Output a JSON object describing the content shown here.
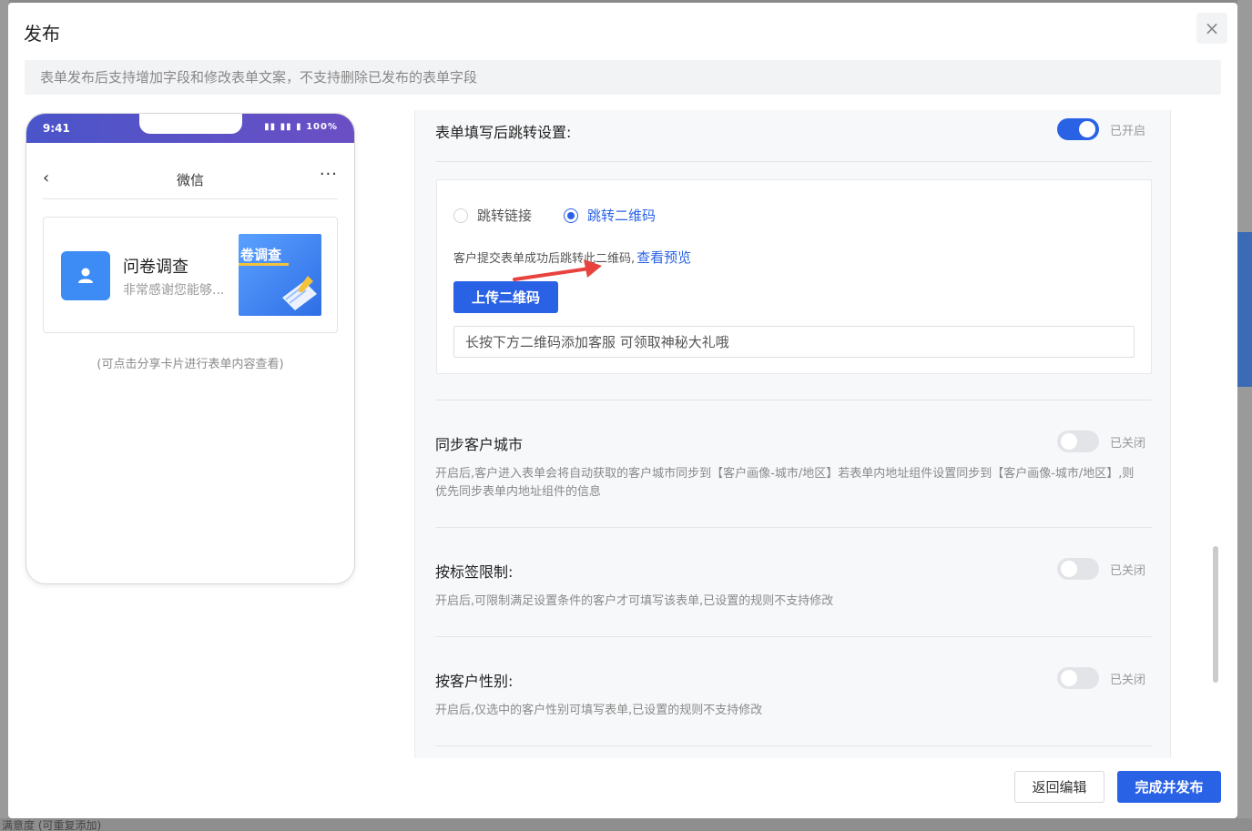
{
  "dialog": {
    "title": "发布",
    "close_icon": "×",
    "notice": "表单发布后支持增加字段和修改表单文案，不支持删除已发布的表单字段"
  },
  "phone": {
    "time": "9:41",
    "indicators": "▮▮ ▮▮ ▮ 100%",
    "nav_back": "‹",
    "nav_title": "微信",
    "nav_more": "···",
    "card": {
      "title": "问卷调查",
      "desc": "非常感谢您能够...",
      "thumb_text": "卷调查"
    },
    "hint": "(可点击分享卡片进行表单内容查看)"
  },
  "settings": {
    "redirect": {
      "label": "表单填写后跳转设置:",
      "state": "已开启",
      "enabled": true,
      "options": [
        {
          "label": "跳转链接",
          "checked": false
        },
        {
          "label": "跳转二维码",
          "checked": true
        }
      ],
      "hint": "客户提交表单成功后跳转此二维码,",
      "preview_link": "查看预览",
      "upload_label": "上传二维码",
      "input_value": "长按下方二维码添加客服 可领取神秘大礼哦"
    },
    "sync_city": {
      "label": "同步客户城市",
      "state": "已关闭",
      "enabled": false,
      "desc": "开启后,客户进入表单会将自动获取的客户城市同步到【客户画像-城市/地区】若表单内地址组件设置同步到【客户画像-城市/地区】,则优先同步表单内地址组件的信息"
    },
    "tag_limit": {
      "label": "按标签限制:",
      "state": "已关闭",
      "enabled": false,
      "desc": "开启后,可限制满足设置条件的客户才可填写该表单,已设置的规则不支持修改"
    },
    "gender": {
      "label": "按客户性别:",
      "state": "已关闭",
      "enabled": false,
      "desc": "开启后,仅选中的客户性别可填写表单,已设置的规则不支持修改"
    }
  },
  "footer": {
    "back_label": "返回编辑",
    "publish_label": "完成并发布"
  },
  "background": {
    "bottom_text": "满意度 (可重复添加)"
  },
  "colors": {
    "primary": "#2a62e6",
    "phone_status": "#5a52c8",
    "annotation_arrow": "#e8433f"
  }
}
